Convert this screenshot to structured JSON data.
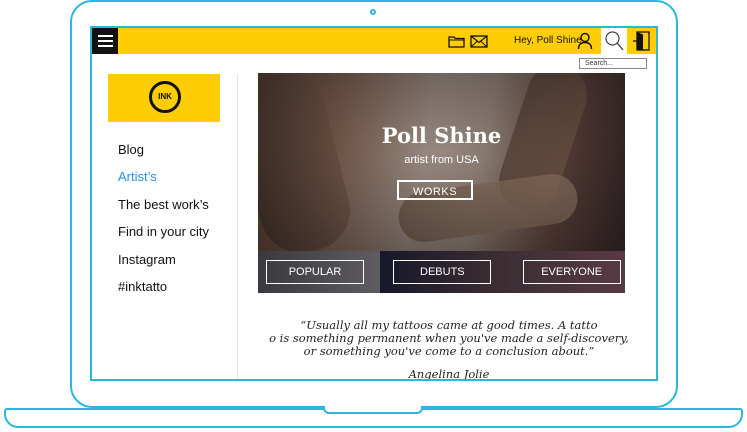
{
  "topbar": {
    "greeting": "Hey, Poll Shine",
    "search_placeholder": "Search..."
  },
  "logo": {
    "text": "INK"
  },
  "nav": {
    "items": [
      {
        "label": "Blog",
        "active": false
      },
      {
        "label": "Artist’s",
        "active": true
      },
      {
        "label": "The best work’s",
        "active": false
      },
      {
        "label": "Find in your city",
        "active": false
      },
      {
        "label": "Instagram",
        "active": false
      },
      {
        "label": "#inktatto",
        "active": false
      }
    ]
  },
  "hero": {
    "name": "Poll Shine",
    "subtitle": "artist from USA",
    "works_label": "WORKS"
  },
  "categories": [
    {
      "label": "POPULAR"
    },
    {
      "label": "DEBUTS"
    },
    {
      "label": "EVERYONE"
    }
  ],
  "quote": {
    "line1": "“Usually all my tattoos came at good times. A tatto",
    "line2": "o is something permanent when you've made a self-discovery,",
    "line3": "or something you've come to a conclusion about.”",
    "author": "Angelina Jolie"
  },
  "colors": {
    "accent": "#ffcd05",
    "frame": "#2bb6dc",
    "link_active": "#2a8fe0"
  }
}
